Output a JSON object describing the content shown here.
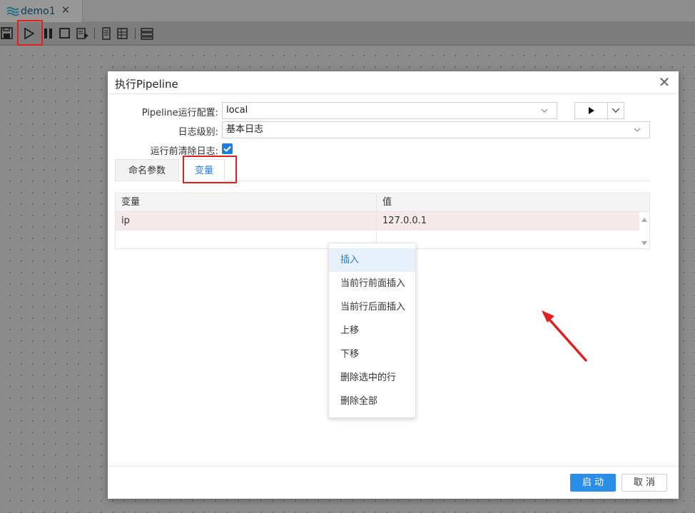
{
  "tab": {
    "label": "demo1",
    "close": "✕"
  },
  "dialog": {
    "title": "执行Pipeline",
    "close": "✕",
    "fields": {
      "run_config_label": "Pipeline运行配置:",
      "run_config_value": "local",
      "log_level_label": "日志级别:",
      "log_level_value": "基本日志",
      "clear_log_label": "运行前清除日志:",
      "clear_log_checked": true
    },
    "tabs": [
      {
        "label": "命名参数"
      },
      {
        "label": "变量"
      }
    ],
    "grid": {
      "headers": [
        "变量",
        "值"
      ],
      "rows": [
        {
          "name": "ip",
          "value": "127.0.0.1"
        }
      ]
    },
    "context_menu": [
      "插入",
      "当前行前面插入",
      "当前行后面插入",
      "上移",
      "下移",
      "删除选中的行",
      "删除全部"
    ],
    "buttons": {
      "start": "启 动",
      "cancel": "取 消"
    }
  },
  "colors": {
    "accent": "#2b8fe8",
    "highlight": "#e02020",
    "selected_row": "#f5e9ea",
    "checkbox": "#1e7fe0"
  }
}
